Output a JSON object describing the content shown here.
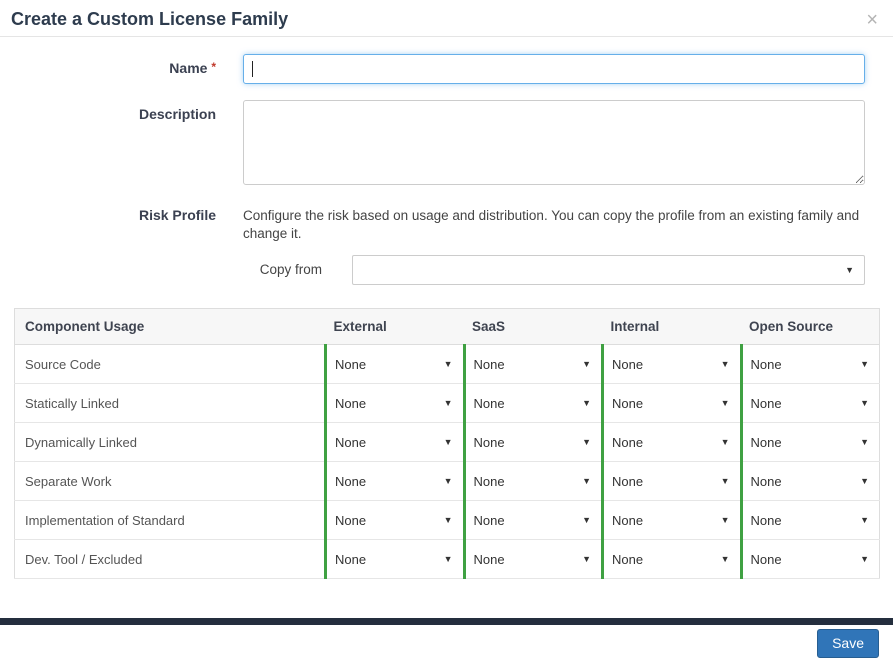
{
  "modal": {
    "title": "Create a Custom License Family",
    "close_icon": "×"
  },
  "form": {
    "name_label": "Name",
    "required_marker": "*",
    "name_value": "",
    "description_label": "Description",
    "description_value": "",
    "risk_profile_label": "Risk Profile",
    "risk_profile_help": "Configure the risk based on usage and distribution. You can copy the profile from an existing family and change it.",
    "copy_from_label": "Copy from",
    "copy_from_value": ""
  },
  "table": {
    "columns": [
      "Component Usage",
      "External",
      "SaaS",
      "Internal",
      "Open Source"
    ],
    "rows": [
      {
        "label": "Source Code",
        "values": [
          "None",
          "None",
          "None",
          "None"
        ]
      },
      {
        "label": "Statically Linked",
        "values": [
          "None",
          "None",
          "None",
          "None"
        ]
      },
      {
        "label": "Dynamically Linked",
        "values": [
          "None",
          "None",
          "None",
          "None"
        ]
      },
      {
        "label": "Separate Work",
        "values": [
          "None",
          "None",
          "None",
          "None"
        ]
      },
      {
        "label": "Implementation of Standard",
        "values": [
          "None",
          "None",
          "None",
          "None"
        ]
      },
      {
        "label": "Dev. Tool / Excluded",
        "values": [
          "None",
          "None",
          "None",
          "None"
        ]
      }
    ]
  },
  "footer": {
    "save_label": "Save"
  },
  "icons": {
    "dropdown_caret": "▼"
  },
  "colors": {
    "accent_green": "#3fa142",
    "primary_blue": "#3075b8",
    "focus_blue": "#66afe9",
    "footer_bar": "#242e3e",
    "header_border": "#e5e5e5",
    "table_border": "#dddddd"
  }
}
